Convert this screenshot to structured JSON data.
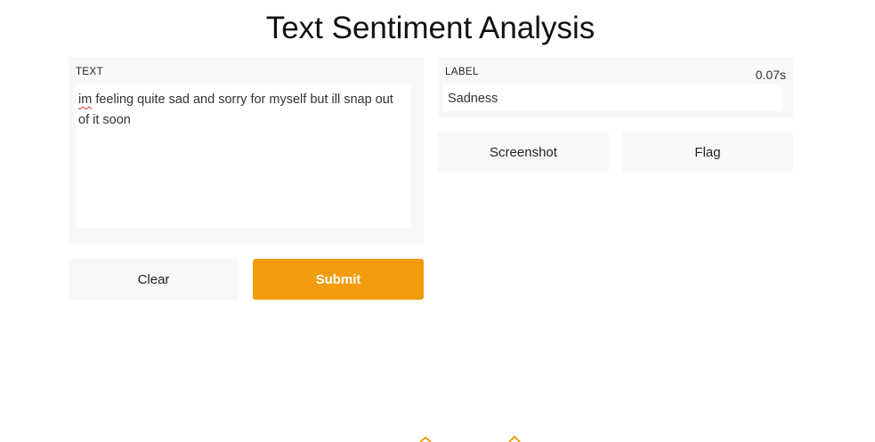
{
  "page": {
    "title": "Text Sentiment Analysis"
  },
  "input": {
    "label": "TEXT",
    "value_first_word": "im",
    "value_rest": " feeling quite sad and sorry for myself but ill snap out of it soon"
  },
  "actions": {
    "clear_label": "Clear",
    "submit_label": "Submit"
  },
  "output": {
    "label": "LABEL",
    "timing": "0.07s",
    "value": "Sadness"
  },
  "output_actions": {
    "screenshot_label": "Screenshot",
    "flag_label": "Flag"
  },
  "colors": {
    "submit_accent": "#f39c0d",
    "panel_bg": "#f7f8fa"
  }
}
